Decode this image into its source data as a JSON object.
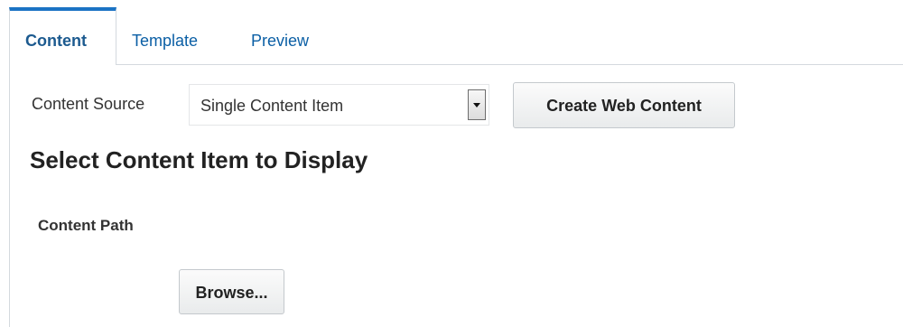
{
  "tabs": [
    {
      "label": "Content",
      "active": true
    },
    {
      "label": "Template",
      "active": false
    },
    {
      "label": "Preview",
      "active": false
    }
  ],
  "content": {
    "source_label": "Content Source",
    "source_value": "Single Content Item",
    "create_button_label": "Create Web Content",
    "section_title": "Select Content Item to Display",
    "path_label": "Content Path",
    "browse_button_label": "Browse..."
  },
  "colors": {
    "tab_accent": "#1b73c4",
    "tab_link": "#0b5fa5"
  }
}
